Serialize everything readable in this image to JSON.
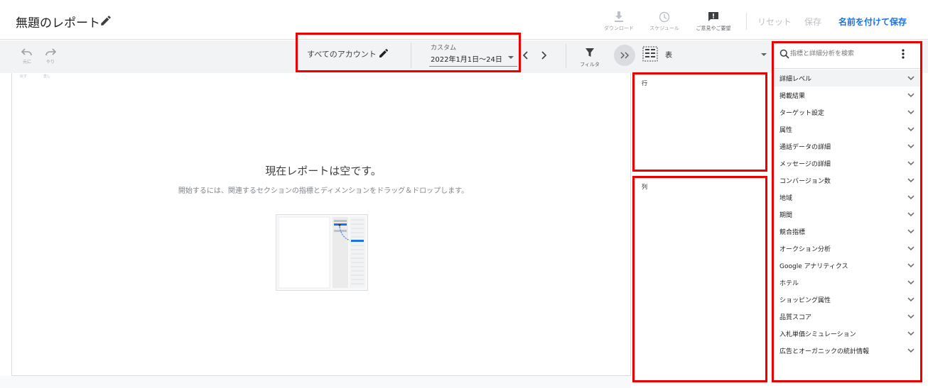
{
  "header": {
    "title": "無題のレポート",
    "tools": [
      {
        "label": "ダウンロード",
        "icon": "download-icon"
      },
      {
        "label": "スケジュール",
        "icon": "clock-icon"
      },
      {
        "label": "ご意見やご要望",
        "icon": "feedback-icon"
      }
    ],
    "reset_label": "リセット",
    "save_label": "保存",
    "save_as_label": "名前を付けて保存"
  },
  "toolbar": {
    "undo_label": "元に",
    "redo_label": "やり",
    "undo_sub": "戻す",
    "redo_sub": "直し",
    "account_label": "すべてのアカウント",
    "date_type": "カスタム",
    "date_range": "2022年1月1日〜24日",
    "filter_label": "フィルタ",
    "visualization_label": "表"
  },
  "canvas": {
    "empty_title": "現在レポートは空です。",
    "empty_description": "開始するには、関連するセクションの指標とディメンションをドラッグ＆ドロップします。"
  },
  "panels": {
    "rows_label": "行",
    "columns_label": "列"
  },
  "sidebar": {
    "search_placeholder": "指標と詳細分析を検索",
    "categories": [
      "詳細レベル",
      "掲載結果",
      "ターゲット設定",
      "属性",
      "通話データの詳細",
      "メッセージの詳細",
      "コンバージョン数",
      "地域",
      "期間",
      "競合指標",
      "オークション分析",
      "Google アナリティクス",
      "ホテル",
      "ショッピング属性",
      "品質スコア",
      "入札単価シミュレーション",
      "広告とオーガニックの統計情報"
    ]
  },
  "colors": {
    "accent": "#1a73e8",
    "highlight": "#e00000",
    "toolbar_bg": "#f1f3f4"
  }
}
